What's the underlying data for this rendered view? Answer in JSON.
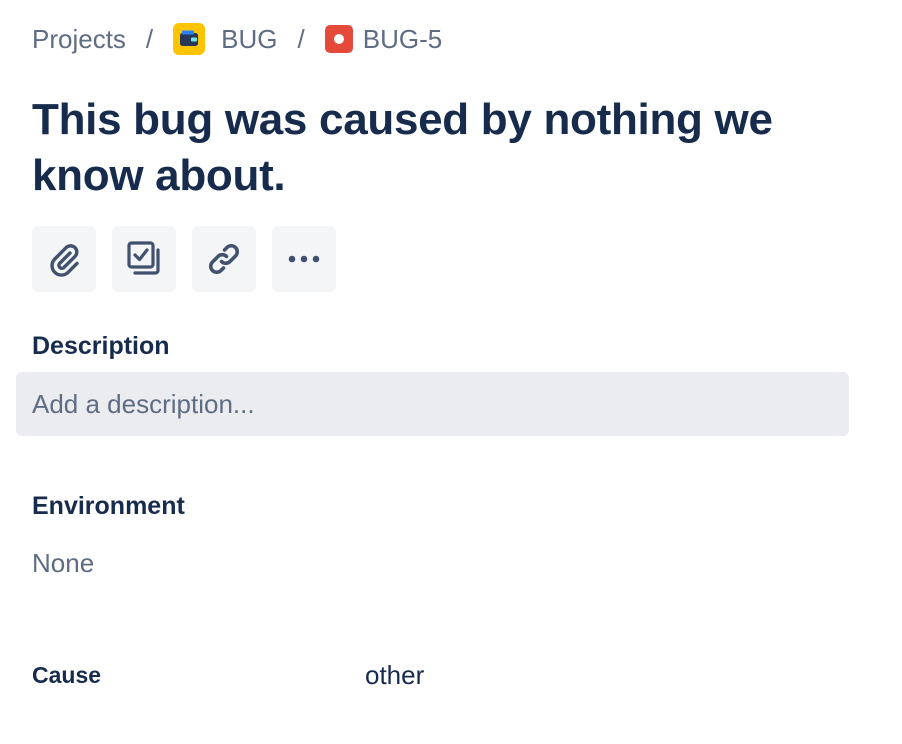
{
  "breadcrumb": {
    "projects_label": "Projects",
    "separator": "/",
    "project_key": "BUG",
    "issue_key": "BUG-5"
  },
  "issue": {
    "title": "This bug was caused by nothing we know about."
  },
  "toolbar": {
    "buttons": [
      {
        "icon": "paperclip-icon",
        "name": "attach-button"
      },
      {
        "icon": "subtask-icon",
        "name": "add-child-issue-button"
      },
      {
        "icon": "link-icon",
        "name": "link-issue-button"
      },
      {
        "icon": "more-icon",
        "name": "more-actions-button"
      }
    ]
  },
  "description": {
    "label": "Description",
    "placeholder": "Add a description..."
  },
  "environment": {
    "label": "Environment",
    "value": "None"
  },
  "cause": {
    "label": "Cause",
    "value": "other"
  },
  "colors": {
    "text_primary": "#172B4D",
    "text_subtle": "#5E6C84",
    "button_bg": "#F4F5F7",
    "input_bg": "#EBECF0",
    "project_avatar": "#FFC400",
    "bug_icon": "#E5493A"
  }
}
